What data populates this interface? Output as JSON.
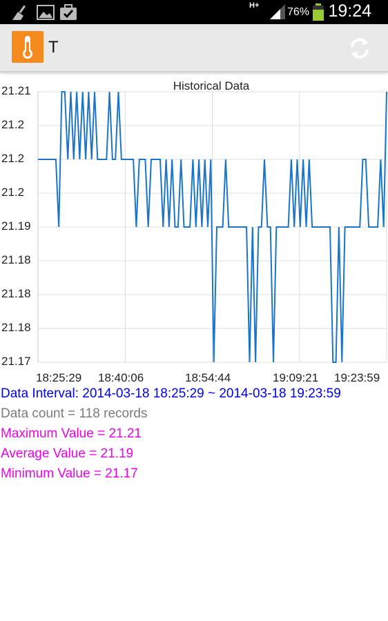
{
  "status_bar": {
    "network": "H+",
    "battery_percent": "76%",
    "time": "19:24",
    "icons": [
      "broom-icon",
      "image-icon",
      "briefcase-check-icon",
      "signal-icon",
      "battery-icon"
    ]
  },
  "action_bar": {
    "app_icon": "thermometer-icon",
    "title": "T",
    "refresh_icon": "refresh-icon"
  },
  "chart_data": {
    "type": "line",
    "title": "Historical Data",
    "xlabel": "",
    "ylabel": "",
    "ytick_labels": [
      "21.21",
      "21.2",
      "21.2",
      "21.2",
      "21.19",
      "21.18",
      "21.18",
      "21.18",
      "21.17"
    ],
    "xtick_labels": [
      "18:25:29",
      "18:40:06",
      "18:54:44",
      "19:09:21",
      "19:23:59"
    ],
    "ylim": [
      21.17,
      21.21
    ],
    "xlim": [
      "18:25:29",
      "19:23:59"
    ],
    "grid": true,
    "line_color": "#1a74c8",
    "series": [
      {
        "values": [
          21.2,
          21.2,
          21.2,
          21.2,
          21.2,
          21.2,
          21.2,
          21.19,
          21.21,
          21.21,
          21.2,
          21.21,
          21.2,
          21.21,
          21.2,
          21.21,
          21.2,
          21.21,
          21.2,
          21.21,
          21.2,
          21.2,
          21.2,
          21.2,
          21.21,
          21.2,
          21.2,
          21.21,
          21.2,
          21.2,
          21.2,
          21.2,
          21.2,
          21.19,
          21.2,
          21.2,
          21.2,
          21.19,
          21.2,
          21.2,
          21.2,
          21.2,
          21.19,
          21.2,
          21.19,
          21.2,
          21.19,
          21.19,
          21.2,
          21.19,
          21.19,
          21.19,
          21.2,
          21.19,
          21.2,
          21.19,
          21.2,
          21.19,
          21.2,
          21.17,
          21.19,
          21.19,
          21.19,
          21.2,
          21.19,
          21.19,
          21.19,
          21.19,
          21.19,
          21.19,
          21.19,
          21.17,
          21.19,
          21.17,
          21.19,
          21.19,
          21.2,
          21.19,
          21.19,
          21.17,
          21.19,
          21.19,
          21.19,
          21.19,
          21.19,
          21.2,
          21.19,
          21.2,
          21.19,
          21.2,
          21.19,
          21.2,
          21.19,
          21.19,
          21.19,
          21.19,
          21.19,
          21.19,
          21.19,
          21.17,
          21.17,
          21.19,
          21.17,
          21.19,
          21.19,
          21.19,
          21.19,
          21.19,
          21.19,
          21.2,
          21.2,
          21.19,
          21.19,
          21.19,
          21.19,
          21.2,
          21.19,
          21.21
        ]
      }
    ]
  },
  "info": {
    "interval": "Data Interval: 2014-03-18 18:25:29 ~ 2014-03-18 19:23:59",
    "count": "Data count = 118 records",
    "max": "Maximum Value = 21.21",
    "avg": "Average Value = 21.19",
    "min": "Minimum Value = 21.17",
    "colors": {
      "interval": "#0000ee",
      "count": "#7a7a7a",
      "stats": "#ee00ee"
    }
  }
}
